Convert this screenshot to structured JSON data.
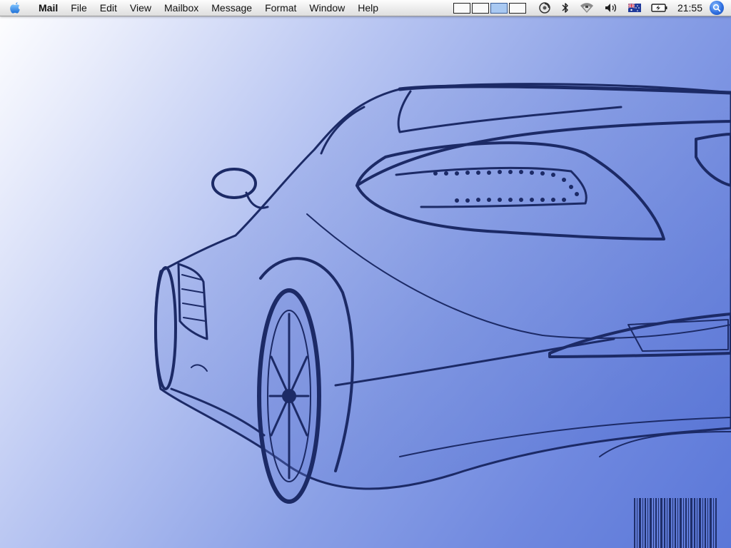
{
  "menubar": {
    "apple_icon": "apple-logo-icon",
    "app_name": "Mail",
    "items": [
      "File",
      "Edit",
      "View",
      "Mailbox",
      "Message",
      "Format",
      "Window",
      "Help"
    ],
    "spaces_active_index": 2,
    "clock": "21:55",
    "tray_icons": [
      "clipboard-spinner-icon",
      "bluetooth-icon",
      "wifi-icon",
      "volume-icon",
      "australia-flag-icon",
      "battery-charging-icon",
      "spotlight-icon"
    ]
  },
  "desktop": {
    "wallpaper": "sports-car-sketch"
  }
}
